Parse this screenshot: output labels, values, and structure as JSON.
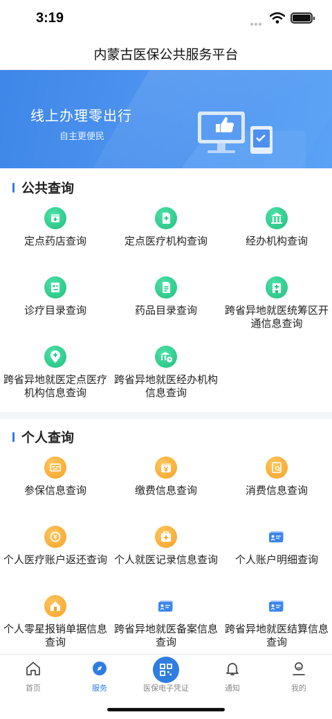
{
  "status_bar": {
    "time": "3:19"
  },
  "nav": {
    "title": "内蒙古医保公共服务平台"
  },
  "banner": {
    "title": "线上办理零出行",
    "subtitle": "自主更便民"
  },
  "public_section": {
    "title": "公共查询",
    "items": [
      {
        "label": "定点药店查询",
        "icon": "pharmacy-icon"
      },
      {
        "label": "定点医疗机构查询",
        "icon": "medical-document-icon"
      },
      {
        "label": "经办机构查询",
        "icon": "institution-building-icon"
      },
      {
        "label": "诊疗目录查询",
        "icon": "treatment-list-icon"
      },
      {
        "label": "药品目录查询",
        "icon": "drug-list-icon"
      },
      {
        "label": "跨省异地就医统筹区开通信息查询",
        "icon": "hospital-plus-icon"
      },
      {
        "label": "跨省异地就医定点医疗机构信息查询",
        "icon": "location-plus-icon"
      },
      {
        "label": "跨省异地就医经办机构信息查询",
        "icon": "bank-clock-icon"
      }
    ]
  },
  "personal_section": {
    "title": "个人查询",
    "items": [
      {
        "label": "参保信息查询",
        "icon": "insurance-card-icon"
      },
      {
        "label": "缴费信息查询",
        "icon": "payment-yuan-icon"
      },
      {
        "label": "消费信息查询",
        "icon": "consumption-receipt-icon"
      },
      {
        "label": "个人医疗账户返还查询",
        "icon": "account-refund-icon"
      },
      {
        "label": "个人就医记录信息查询",
        "icon": "medical-record-icon"
      },
      {
        "label": "个人账户明细查询",
        "icon": "account-card-icon"
      },
      {
        "label": "个人零星报销单据信息查询",
        "icon": "home-reimbursement-icon"
      },
      {
        "label": "跨省异地就医备案信息查询",
        "icon": "filing-card-icon"
      },
      {
        "label": "跨省异地就医结算信息查询",
        "icon": "settlement-card-icon"
      }
    ]
  },
  "tabbar": {
    "items": [
      {
        "label": "首页",
        "icon": "home-icon"
      },
      {
        "label": "服务",
        "icon": "compass-icon",
        "active": true
      },
      {
        "label": "医保电子凭证",
        "icon": "qr-code-icon"
      },
      {
        "label": "通知",
        "icon": "bell-icon"
      },
      {
        "label": "我的",
        "icon": "user-icon"
      }
    ]
  },
  "colors": {
    "accent": "#2f7de1",
    "green_icon": "#22c17f",
    "orange_icon": "#f7a72a",
    "banner": "#4a8fec"
  }
}
